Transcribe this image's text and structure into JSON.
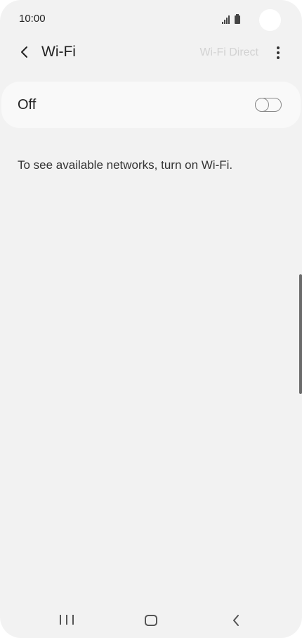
{
  "status_bar": {
    "time": "10:00",
    "icons": [
      "signal-icon",
      "battery-icon"
    ]
  },
  "app_bar": {
    "back_icon": "chevron-left-icon",
    "title": "Wi-Fi",
    "wifi_direct_label": "Wi-Fi Direct",
    "more_icon": "more-vertical-icon"
  },
  "wifi_toggle": {
    "label": "Off",
    "state": "off"
  },
  "info": {
    "message": "To see available networks, turn on Wi-Fi."
  },
  "nav_bar": {
    "icons": [
      "recents-icon",
      "home-icon",
      "back-icon"
    ]
  },
  "colors": {
    "background": "#f2f2f2",
    "card": "#f9f9f9",
    "text": "#222222",
    "disabled_text": "#d2d2d2"
  }
}
